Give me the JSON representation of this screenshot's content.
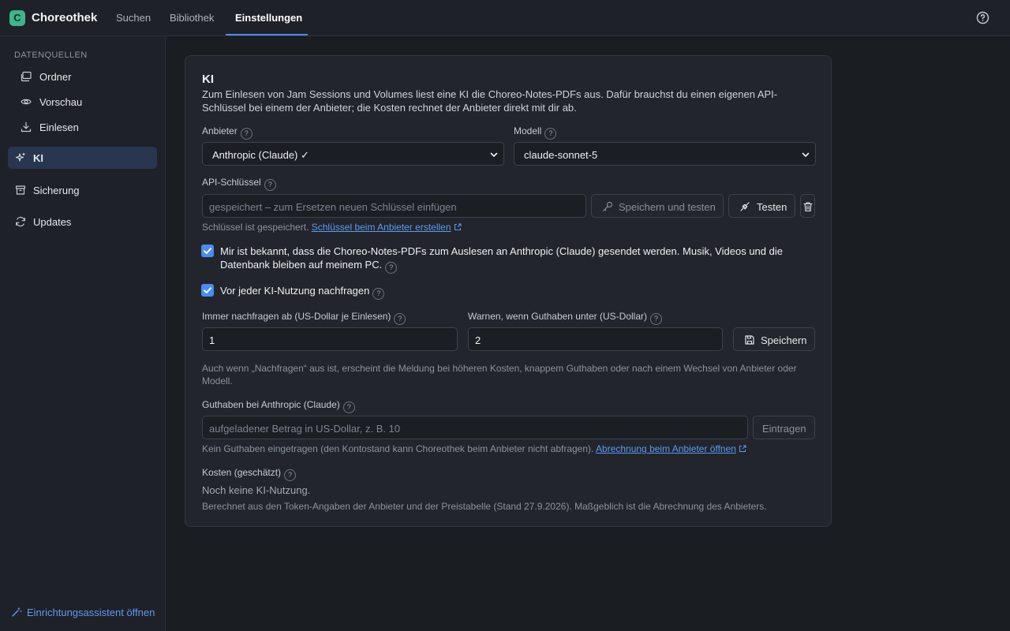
{
  "app": {
    "logo_letter": "C",
    "title": "Choreothek",
    "tabs": [
      {
        "label": "Suchen"
      },
      {
        "label": "Bibliothek"
      },
      {
        "label": "Einstellungen",
        "active": true
      }
    ],
    "help_icon": "help-circle-icon"
  },
  "sidebar": {
    "section_label": "DATENQUELLEN",
    "items": [
      {
        "label": "Ordner",
        "icon": "folders-icon"
      },
      {
        "label": "Vorschau",
        "icon": "eye-icon"
      },
      {
        "label": "Einlesen",
        "icon": "download-icon"
      },
      {
        "label": "KI",
        "icon": "sparkles-icon",
        "active": true
      },
      {
        "label": "Sicherung",
        "icon": "archive-icon"
      },
      {
        "label": "Updates",
        "icon": "refresh-icon"
      }
    ],
    "footer_link": "Einrichtungsassistent öffnen"
  },
  "ki": {
    "title": "KI",
    "description": "Zum Einlesen von Jam Sessions und Volumes liest eine KI die Choreo-Notes-PDFs aus. Dafür brauchst du einen eigenen API-Schlüssel bei einem der Anbieter; die Kosten rechnet der Anbieter direkt mit dir ab.",
    "provider": {
      "label": "Anbieter",
      "value": "Anthropic (Claude) ✓"
    },
    "model": {
      "label": "Modell",
      "value": "claude-sonnet-5"
    },
    "api_key": {
      "label": "API-Schlüssel",
      "placeholder": "gespeichert – zum Ersetzen neuen Schlüssel einfügen",
      "save_test_label": "Speichern und testen",
      "test_label": "Testen",
      "status_text": "Schlüssel ist gespeichert.",
      "create_link": "Schlüssel beim Anbieter erstellen"
    },
    "consent": {
      "checked": true,
      "label": "Mir ist bekannt, dass die Choreo-Notes-PDFs zum Auslesen an Anthropic (Claude) gesendet werden. Musik, Videos und die Datenbank bleiben auf meinem PC."
    },
    "ask_before": {
      "checked": true,
      "label": "Vor jeder KI-Nutzung nachfragen"
    },
    "ask_threshold": {
      "label": "Immer nachfragen ab (US-Dollar je Einlesen)",
      "value": "1"
    },
    "warn_threshold": {
      "label": "Warnen, wenn Guthaben unter (US-Dollar)",
      "value": "2"
    },
    "save_label": "Speichern",
    "threshold_hint": "Auch wenn „Nachfragen“ aus ist, erscheint die Meldung bei höheren Kosten, knappem Guthaben oder nach einem Wechsel von Anbieter oder Modell.",
    "balance": {
      "label": "Guthaben bei Anthropic (Claude)",
      "placeholder": "aufgeladener Betrag in US-Dollar, z. B. 10",
      "button": "Eintragen",
      "hint": "Kein Guthaben eingetragen (den Kontostand kann Choreothek beim Anbieter nicht abfragen).",
      "billing_link": "Abrechnung beim Anbieter öffnen"
    },
    "costs": {
      "label": "Kosten (geschätzt)",
      "value": "Noch keine KI-Nutzung.",
      "hint": "Berechnet aus den Token-Angaben der Anbieter und der Preistabelle (Stand 27.9.2026). Maßgeblich ist die Abrechnung des Anbieters."
    },
    "help_marker": "?"
  },
  "colors": {
    "accent": "#4a8cf0",
    "link": "#5b9bf5",
    "logo": "#3fb58a",
    "active_nav": "#283650"
  }
}
